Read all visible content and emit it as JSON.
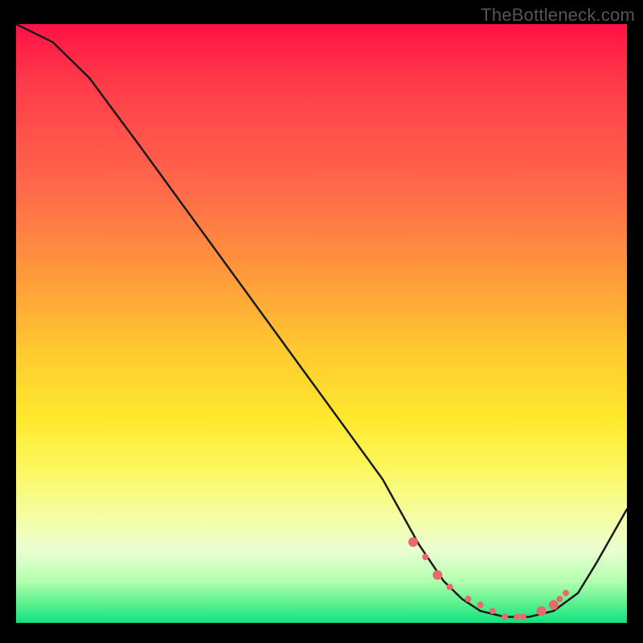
{
  "watermark": "TheBottleneck.com",
  "chart_data": {
    "type": "line",
    "title": "",
    "xlabel": "",
    "ylabel": "",
    "xlim": [
      0,
      100
    ],
    "ylim": [
      0,
      100
    ],
    "series": [
      {
        "name": "curve",
        "x": [
          0,
          6,
          12,
          20,
          30,
          40,
          50,
          60,
          66,
          70,
          73,
          76,
          80,
          84,
          88,
          92,
          95,
          100
        ],
        "y": [
          100,
          97,
          91,
          80,
          66,
          52,
          38,
          24,
          13,
          7,
          4,
          2,
          1,
          1,
          2,
          5,
          10,
          19
        ]
      }
    ],
    "markers": {
      "name": "highlight-points",
      "x": [
        65,
        67,
        69,
        71,
        74,
        76,
        78,
        80,
        82,
        83,
        86,
        88,
        89,
        90
      ],
      "y": [
        13.5,
        11,
        8,
        6,
        4,
        3,
        2,
        1,
        1,
        1,
        2,
        3,
        4,
        5
      ],
      "size": [
        "big",
        "small",
        "big",
        "small",
        "small",
        "small",
        "small",
        "small",
        "small",
        "small",
        "big",
        "big",
        "small",
        "small"
      ]
    },
    "gradient_stops": [
      {
        "pos": 0,
        "color": "#ff1245"
      },
      {
        "pos": 10,
        "color": "#ff3b4a"
      },
      {
        "pos": 28,
        "color": "#ff6b4a"
      },
      {
        "pos": 42,
        "color": "#ff9a3a"
      },
      {
        "pos": 55,
        "color": "#ffcb2f"
      },
      {
        "pos": 66,
        "color": "#ffe92e"
      },
      {
        "pos": 74,
        "color": "#fbf75c"
      },
      {
        "pos": 82,
        "color": "#f5fda2"
      },
      {
        "pos": 88,
        "color": "#e9ffd2"
      },
      {
        "pos": 93,
        "color": "#b3ffaf"
      },
      {
        "pos": 97,
        "color": "#55f08e"
      },
      {
        "pos": 100,
        "color": "#13e07f"
      }
    ]
  }
}
